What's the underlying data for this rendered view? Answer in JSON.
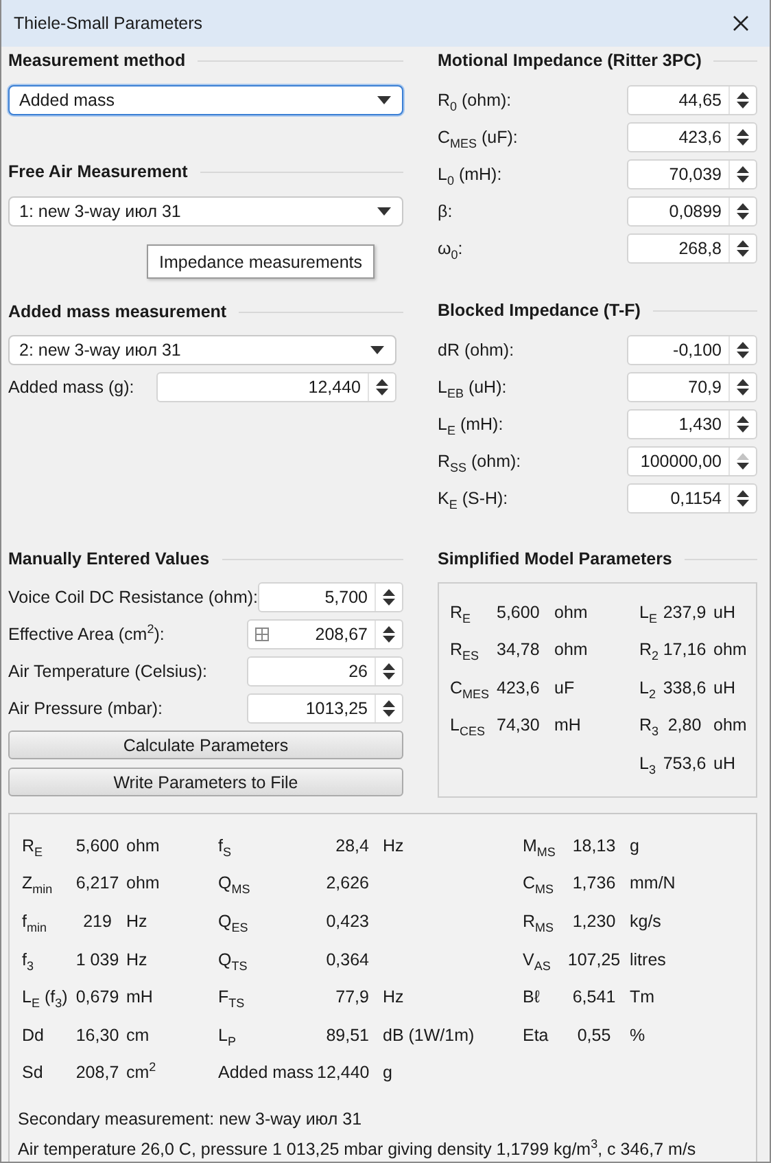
{
  "window": {
    "title": "Thiele-Small Parameters"
  },
  "measurement_method": {
    "heading": "Measurement method",
    "dropdown": {
      "value": "Added mass",
      "focused": true
    }
  },
  "free_air_measurement": {
    "heading": "Free Air Measurement",
    "dropdown": {
      "value": "1: new 3-way июл 31",
      "focused": false
    },
    "button": {
      "label": "Impedance measurements"
    }
  },
  "added_mass_measurement": {
    "heading": "Added mass measurement",
    "dropdown": {
      "value": "2: new 3-way июл 31",
      "focused": false
    },
    "fields": [
      {
        "label": "Added mass (g):",
        "value": "12,440",
        "at_max": false
      }
    ]
  },
  "motional_impedance": {
    "heading": "Motional Impedance (Ritter 3PC)",
    "fields": [
      {
        "label": "R$_{0}$ (ohm):",
        "value": "44,65",
        "at_max": false
      },
      {
        "label": "C$_{MES}$ (uF):",
        "value": "423,6",
        "at_max": false
      },
      {
        "label": "L$_{0}$ (mH):",
        "value": "70,039",
        "at_max": false
      },
      {
        "label": "β:",
        "value": "0,0899",
        "at_max": false
      },
      {
        "label": "ω$_{0}$:",
        "value": "268,8",
        "at_max": false
      }
    ]
  },
  "blocked_impedance": {
    "heading": "Blocked Impedance (T-F)",
    "fields": [
      {
        "label": "dR (ohm):",
        "value": "-0,100",
        "at_max": false
      },
      {
        "label": "L$_{EB}$ (uH):",
        "value": "70,9",
        "at_max": false
      },
      {
        "label": "L$_{E}$ (mH):",
        "value": "1,430",
        "at_max": false
      },
      {
        "label": "R$_{SS}$ (ohm):",
        "value": "100000,00",
        "at_max": true
      },
      {
        "label": "K$_{E}$ (S-H):",
        "value": "0,1154",
        "at_max": false
      }
    ]
  },
  "manually_entered_values": {
    "heading": "Manually Entered Values",
    "fields": [
      {
        "label": "Voice Coil DC Resistance (ohm):",
        "value": "5,700",
        "calculator": false,
        "at_max": false
      },
      {
        "label": "Effective Area (cm$^{2}$):",
        "value": "208,67",
        "calculator": true,
        "at_max": false
      },
      {
        "label": "Air Temperature (Celsius):",
        "value": "26",
        "calculator": false,
        "at_max": false
      },
      {
        "label": "Air Pressure (mbar):",
        "value": "1013,25",
        "calculator": false,
        "at_max": false
      }
    ],
    "buttons": [
      {
        "label": "Calculate Parameters"
      },
      {
        "label": "Write Parameters to File"
      }
    ]
  },
  "simplified_model_parameters": {
    "heading": "Simplified Model Parameters",
    "columns": [
      [
        {
          "symbol": "R$_{E}$",
          "value": "5,600",
          "unit": "ohm"
        },
        {
          "symbol": "R$_{ES}$",
          "value": "34,78",
          "unit": "ohm"
        },
        {
          "symbol": "C$_{MES}$",
          "value": "423,6",
          "unit": "uF"
        },
        {
          "symbol": "L$_{CES}$",
          "value": "74,30",
          "unit": "mH"
        }
      ],
      [
        {
          "symbol": "L$_{E}$",
          "value": "237,9",
          "unit": "uH"
        },
        {
          "symbol": "R$_{2}$",
          "value": "17,16",
          "unit": "ohm"
        },
        {
          "symbol": "L$_{2}$",
          "value": "338,6",
          "unit": "uH"
        },
        {
          "symbol": "R$_{3}$",
          "value": "2,80",
          "unit": "ohm"
        },
        {
          "symbol": "L$_{3}$",
          "value": "753,6",
          "unit": "uH"
        }
      ]
    ]
  },
  "results": {
    "columns": [
      [
        {
          "symbol": "R$_{E}$",
          "value": "5,600",
          "unit": "ohm"
        },
        {
          "symbol": "Z$_{min}$",
          "value": "6,217",
          "unit": "ohm"
        },
        {
          "symbol": "f$_{min}$",
          "value": "219",
          "unit": "Hz"
        },
        {
          "symbol": "f$_{3}$",
          "value": "1 039",
          "unit": "Hz"
        },
        {
          "symbol": "L$_{E}$ (f$_{3}$)",
          "value": "0,679",
          "unit": "mH"
        },
        {
          "symbol": "Dd",
          "value": "16,30",
          "unit": "cm"
        },
        {
          "symbol": "Sd",
          "value": "208,7",
          "unit": "cm$^{2}$"
        }
      ],
      [
        {
          "symbol": "f$_{S}$",
          "value": "28,4",
          "unit": "Hz"
        },
        {
          "symbol": "Q$_{MS}$",
          "value": "2,626"
        },
        {
          "symbol": "Q$_{ES}$",
          "value": "0,423"
        },
        {
          "symbol": "Q$_{TS}$",
          "value": "0,364"
        },
        {
          "symbol": "F$_{TS}$",
          "value": "77,9",
          "unit": "Hz"
        },
        {
          "symbol": "L$_{P}$",
          "value": "89,51",
          "unit": "dB (1W/1m)"
        },
        {
          "symbol": "Added mass",
          "value": "12,440",
          "unit": "g"
        }
      ],
      [
        {
          "symbol": "M$_{MS}$",
          "value": "18,13",
          "unit": "g"
        },
        {
          "symbol": "C$_{MS}$",
          "value": "1,736",
          "unit": "mm/N"
        },
        {
          "symbol": "R$_{MS}$",
          "value": "1,230",
          "unit": "kg/s"
        },
        {
          "symbol": "V$_{AS}$",
          "value": "107,25",
          "unit": "litres"
        },
        {
          "symbol": "Bℓ",
          "value": "6,541",
          "unit": "Tm"
        },
        {
          "symbol": "Eta",
          "value": "0,55",
          "unit": "%"
        }
      ]
    ],
    "notes": [
      "Secondary measurement: new 3-way июл 31",
      "Air temperature 26,0 C, pressure 1 013,25 mbar giving density 1,1799 kg/m$^{3}$, c 346,7 m/s"
    ]
  }
}
